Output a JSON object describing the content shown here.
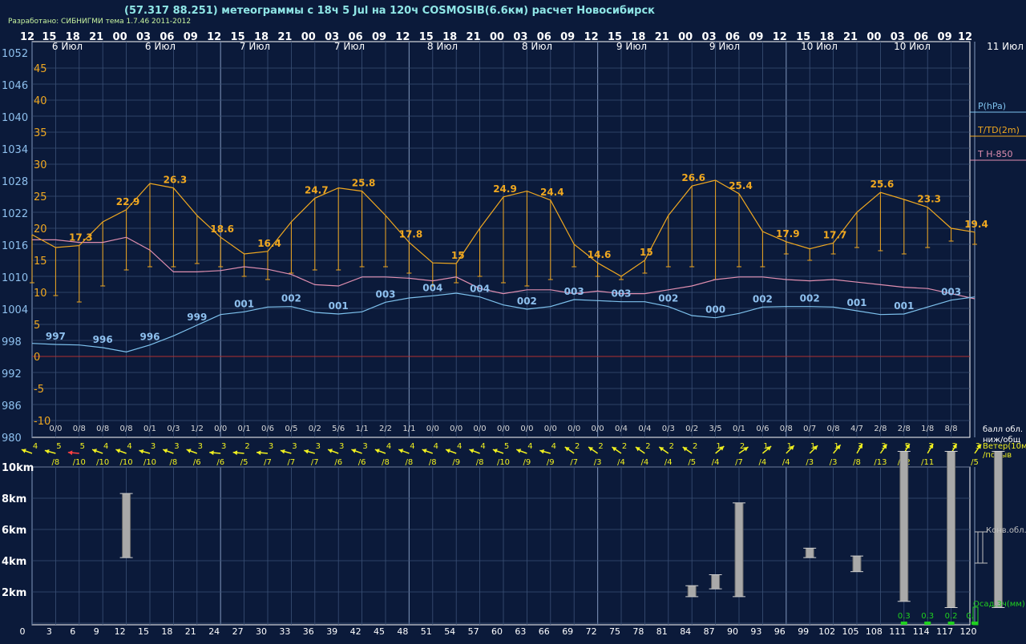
{
  "header": {
    "title": "(57.317 88.251) метеограммы с  18ч 5 Jul на 120ч COSMOSIB(6.6км) расчет Новосибирск",
    "credit": "Разработано: СИБНИГМИ тема 1.7.46 2011-2012"
  },
  "chart_data": {
    "type": "line",
    "time_hours": [
      "12",
      "15",
      "18",
      "21",
      "00",
      "03",
      "06",
      "09",
      "12",
      "15",
      "18",
      "21",
      "00",
      "03",
      "06",
      "09",
      "12",
      "15",
      "18",
      "21",
      "00",
      "03",
      "06",
      "09",
      "12",
      "15",
      "18",
      "21",
      "00",
      "03",
      "06",
      "09",
      "12",
      "15",
      "18",
      "21",
      "00",
      "03",
      "06",
      "09",
      "12"
    ],
    "date_labels": [
      "6 Июл",
      "6 Июл",
      "7 Июл",
      "7 Июл",
      "8 Июл",
      "8 Июл",
      "9 Июл",
      "9 Июл",
      "10 Июл",
      "10 Июл",
      "11 Июл"
    ],
    "forecast_hours": [
      0,
      3,
      6,
      9,
      12,
      15,
      18,
      21,
      24,
      27,
      30,
      33,
      36,
      39,
      42,
      45,
      48,
      51,
      54,
      57,
      60,
      63,
      66,
      69,
      72,
      75,
      78,
      81,
      84,
      87,
      90,
      93,
      96,
      99,
      102,
      105,
      108,
      111,
      114,
      117,
      120
    ],
    "pressure_axis": {
      "ticks": [
        1052,
        1046,
        1040,
        1034,
        1028,
        1022,
        1016,
        1010,
        1004,
        998,
        992,
        986,
        980
      ],
      "range": [
        980,
        1052
      ]
    },
    "temperature_axis": {
      "ticks": [
        45,
        40,
        35,
        30,
        25,
        20,
        15,
        10,
        5,
        0,
        -5,
        -10
      ],
      "range": [
        -10,
        45
      ]
    },
    "legend": [
      {
        "name": "P(hPa)",
        "color": "#7ec2ee"
      },
      {
        "name": "T/TD(2m)",
        "color": "#f0a820"
      },
      {
        "name": "T H-850",
        "color": "#e08fb0"
      }
    ],
    "series": [
      {
        "name": "T/TD(2m)",
        "color": "#f0a820",
        "values": [
          19.0,
          17.0,
          17.3,
          21.0,
          22.9,
          27.0,
          26.3,
          22.0,
          18.6,
          16.0,
          16.4,
          21.0,
          24.7,
          26.3,
          25.8,
          22.0,
          17.8,
          14.6,
          14.5,
          20.0,
          24.9,
          25.8,
          24.4,
          17.5,
          14.6,
          12.5,
          15.0,
          22.0,
          26.6,
          27.5,
          25.4,
          19.5,
          17.9,
          16.8,
          17.7,
          22.5,
          25.6,
          24.5,
          23.3,
          20.0,
          19.4
        ]
      },
      {
        "name": "TD",
        "color": "#f0a820",
        "values": [
          11.5,
          9.5,
          8.5,
          11.0,
          13.5,
          14.0,
          14.0,
          14.5,
          14.0,
          12.5,
          12.0,
          13.0,
          13.5,
          13.5,
          14.0,
          14.0,
          13.0,
          11.0,
          11.5,
          12.5,
          11.5,
          11.0,
          12.0,
          14.0,
          12.5,
          12.0,
          13.0,
          14.0,
          14.0,
          12.0,
          14.0,
          14.0,
          16.0,
          15.0,
          16.0,
          17.0,
          16.5,
          16.0,
          17.0,
          18.0,
          17.5
        ]
      },
      {
        "name": "P(hPa)",
        "color": "#7ec2ee",
        "values": [
          997.6,
          997.4,
          997.3,
          996.8,
          996.0,
          997.3,
          999.0,
          1001.0,
          1003.0,
          1003.5,
          1004.4,
          1004.5,
          1003.4,
          1003.1,
          1003.5,
          1005.3,
          1006.1,
          1006.5,
          1007.0,
          1006.3,
          1004.8,
          1004.0,
          1004.5,
          1005.8,
          1005.6,
          1005.4,
          1005.4,
          1004.5,
          1002.8,
          1002.4,
          1003.2,
          1004.4,
          1004.5,
          1004.5,
          1004.4,
          1003.7,
          1003.0,
          1003.1,
          1004.4,
          1005.7,
          1006.3
        ]
      },
      {
        "name": "T H-850",
        "color": "#e08fb0",
        "values": [
          18.2,
          18.2,
          17.8,
          17.8,
          18.6,
          16.6,
          13.2,
          13.2,
          13.4,
          14.0,
          13.6,
          12.8,
          11.2,
          11.0,
          12.4,
          12.4,
          12.2,
          11.8,
          12.4,
          10.6,
          9.8,
          10.4,
          10.4,
          9.8,
          10.2,
          9.8,
          9.8,
          10.4,
          11.0,
          12.0,
          12.4,
          12.4,
          12.0,
          11.8,
          12.0,
          11.6,
          11.2,
          10.8,
          10.6,
          9.8,
          9.0
        ]
      }
    ],
    "temp_labels": [
      {
        "i": 2,
        "text": "17.3"
      },
      {
        "i": 4,
        "text": "22.9"
      },
      {
        "i": 6,
        "text": "26.3"
      },
      {
        "i": 8,
        "text": "18.6"
      },
      {
        "i": 10,
        "text": "16.4"
      },
      {
        "i": 12,
        "text": "24.7"
      },
      {
        "i": 14,
        "text": "25.8"
      },
      {
        "i": 16,
        "text": "17.8"
      },
      {
        "i": 18,
        "text": "15"
      },
      {
        "i": 20,
        "text": "24.9"
      },
      {
        "i": 22,
        "text": "24.4"
      },
      {
        "i": 24,
        "text": "14.6"
      },
      {
        "i": 26,
        "text": "15"
      },
      {
        "i": 28,
        "text": "26.6"
      },
      {
        "i": 30,
        "text": "25.4"
      },
      {
        "i": 32,
        "text": "17.9"
      },
      {
        "i": 34,
        "text": "17.7"
      },
      {
        "i": 36,
        "text": "25.6"
      },
      {
        "i": 38,
        "text": "23.3"
      },
      {
        "i": 40,
        "text": "19.4"
      }
    ],
    "pressure_labels": [
      {
        "i": 1,
        "text": "997"
      },
      {
        "i": 3,
        "text": "996"
      },
      {
        "i": 5,
        "text": "996"
      },
      {
        "i": 7,
        "text": "999"
      },
      {
        "i": 9,
        "text": "001"
      },
      {
        "i": 11,
        "text": "002"
      },
      {
        "i": 13,
        "text": "001"
      },
      {
        "i": 15,
        "text": "003"
      },
      {
        "i": 17,
        "text": "004"
      },
      {
        "i": 19,
        "text": "004"
      },
      {
        "i": 21,
        "text": "002"
      },
      {
        "i": 23,
        "text": "003"
      },
      {
        "i": 25,
        "text": "003"
      },
      {
        "i": 27,
        "text": "002"
      },
      {
        "i": 29,
        "text": "000"
      },
      {
        "i": 31,
        "text": "002"
      },
      {
        "i": 33,
        "text": "002"
      },
      {
        "i": 35,
        "text": "001"
      },
      {
        "i": 37,
        "text": "001"
      },
      {
        "i": 39,
        "text": "003"
      }
    ],
    "cloud_cover": [
      "0/0",
      "0/8",
      "0/8",
      "0/8",
      "0/1",
      "0/3",
      "1/2",
      "0/0",
      "0/1",
      "0/6",
      "0/5",
      "0/2",
      "5/6",
      "1/1",
      "2/2",
      "1/1",
      "0/0",
      "0/0",
      "0/0",
      "0/0",
      "0/0",
      "0/0",
      "0/0",
      "0/0",
      "0/4",
      "0/4",
      "0/3",
      "0/2",
      "3/5",
      "0/1",
      "0/6",
      "0/8",
      "0/7",
      "0/8",
      "4/7",
      "2/8",
      "2/8",
      "1/8",
      "8/8"
    ],
    "cloud_label": "балл обл.\nниж/общ",
    "wind_speed": [
      "4",
      "5",
      "5",
      "4",
      "4",
      "3",
      "3",
      "3",
      "3",
      "2",
      "3",
      "3",
      "3",
      "3",
      "3",
      "4",
      "4",
      "4",
      "4",
      "4",
      "5",
      "4",
      "4",
      "2",
      "2",
      "2",
      "2",
      "2",
      "2",
      "1",
      "2",
      "1",
      "1",
      "1",
      "1",
      "3",
      "3",
      "5",
      "3",
      "3",
      "3"
    ],
    "wind_gust": [
      "/8",
      "/10",
      "/10",
      "/10",
      "/10",
      "/8",
      "/6",
      "/6",
      "/5",
      "/7",
      "/7",
      "/7",
      "/6",
      "/6",
      "/8",
      "/8",
      "/8",
      "/9",
      "/8",
      "/10",
      "/9",
      "/9",
      "/7",
      "/3",
      "/4",
      "/4",
      "/4",
      "/5",
      "/4",
      "/7",
      "/4",
      "/4",
      "/3",
      "/3",
      "/8",
      "/13",
      "/12",
      "/11",
      "/7",
      "/5"
    ],
    "wind_dir_deg": [
      -160,
      -165,
      -175,
      -160,
      -160,
      -165,
      -160,
      -160,
      -175,
      -175,
      -175,
      -165,
      -165,
      -160,
      -160,
      -160,
      -160,
      -160,
      -160,
      -160,
      -160,
      -160,
      -165,
      -145,
      -145,
      -145,
      -145,
      -145,
      -145,
      -40,
      -35,
      -40,
      -45,
      -45,
      -50,
      -60,
      -55,
      -60,
      -60,
      -60,
      -55
    ],
    "wind_label": "Ветер(10м)\n/порыв",
    "conv_cloud_axis": {
      "ticks": [
        "10km",
        "8km",
        "6km",
        "4km",
        "2km"
      ],
      "range": [
        0,
        11
      ]
    },
    "conv_clouds": [
      {
        "i": 4,
        "base": 4.2,
        "top": 8.3
      },
      {
        "i": 28,
        "base": 1.7,
        "top": 2.4
      },
      {
        "i": 29,
        "base": 2.2,
        "top": 3.1
      },
      {
        "i": 30,
        "base": 1.7,
        "top": 7.7
      },
      {
        "i": 33,
        "base": 4.2,
        "top": 4.8
      },
      {
        "i": 35,
        "base": 3.3,
        "top": 4.3
      },
      {
        "i": 37,
        "base": 1.4,
        "top": 11.0
      },
      {
        "i": 39,
        "base": 1.0,
        "top": 11.0
      },
      {
        "i": 41,
        "base": 1.0,
        "top": 11.0
      }
    ],
    "conv_label": "Конв.обл.",
    "precip": [
      {
        "i": 37,
        "text": "0.3"
      },
      {
        "i": 38,
        "text": "0.3"
      },
      {
        "i": 39,
        "text": "0.2"
      },
      {
        "i": 40,
        "text": "0."
      }
    ],
    "precip_label": "Осад.3ч(мм)"
  }
}
